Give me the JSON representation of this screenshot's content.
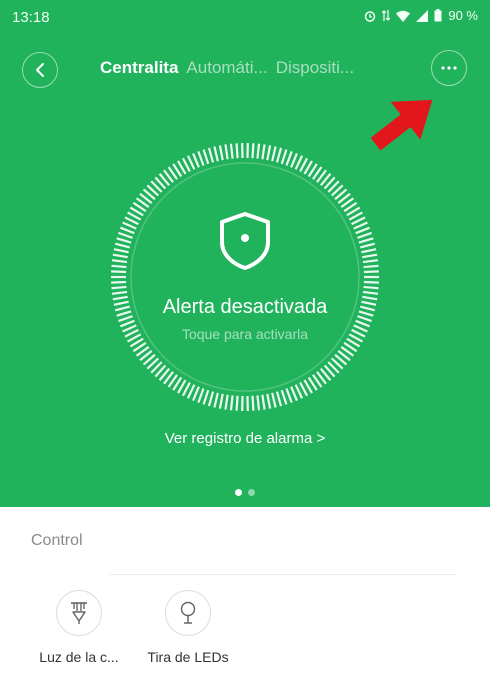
{
  "status_bar": {
    "time": "13:18",
    "battery": "90 %"
  },
  "nav": {
    "tabs": [
      "Centralita",
      "Automáti...",
      "Dispositi..."
    ],
    "active_tab": 0
  },
  "alarm": {
    "title": "Alerta desactivada",
    "subtitle": "Toque para activarla",
    "log_link": "Ver registro de alarma  >"
  },
  "pager": {
    "pages": 2,
    "current": 1
  },
  "control": {
    "title": "Control",
    "devices": [
      {
        "label": "Luz de la c...",
        "icon": "ceiling-lamp-icon"
      },
      {
        "label": "Tira de LEDs",
        "icon": "bulb-icon"
      }
    ]
  },
  "colors": {
    "primary": "#21b25c",
    "annotation_arrow": "#e3161b"
  }
}
